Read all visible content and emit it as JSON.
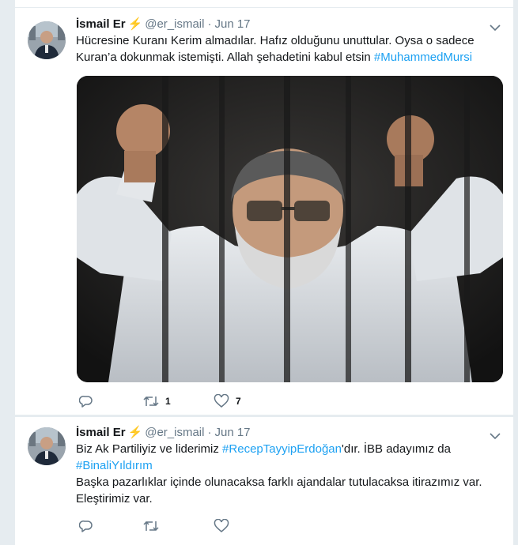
{
  "tweets": [
    {
      "name": "İsmail Er",
      "badge": "⚡",
      "handle": "@er_ismail",
      "separator": "·",
      "date": "Jun 17",
      "text_plain": "Hücresine Kuranı Kerim almadılar. Hafız olduğunu unuttular. Oysa o sadece Kuran’a dokunmak istemişti. Allah şehadetini kabul etsin ",
      "hashtag": "#MuhammedMursi",
      "image_alt": "photo",
      "replies": "",
      "retweets": "1",
      "likes": "7"
    },
    {
      "name": "İsmail Er",
      "badge": "⚡",
      "handle": "@er_ismail",
      "separator": "·",
      "date": "Jun 17",
      "text_a": "Biz Ak Partiliyiz ve liderimiz ",
      "hashtag_a": "#RecepTayyipErdoğan",
      "text_b": "'dır. İBB adayımız da ",
      "hashtag_b": "#BinaliYıldırım",
      "text_c": "Başka pazarlıklar içinde olunacaksa farklı ajandalar tutulacaksa itirazımız var. Eleştirimiz var.",
      "replies": "",
      "retweets": "",
      "likes": ""
    }
  ],
  "icons": {
    "reply": "reply-icon",
    "retweet": "retweet-icon",
    "like": "heart-icon",
    "caret": "chevron-down-icon"
  },
  "colors": {
    "link": "#1da1f2",
    "meta": "#657786",
    "background": "#e6ecf0",
    "bolt": "#ffac33"
  }
}
